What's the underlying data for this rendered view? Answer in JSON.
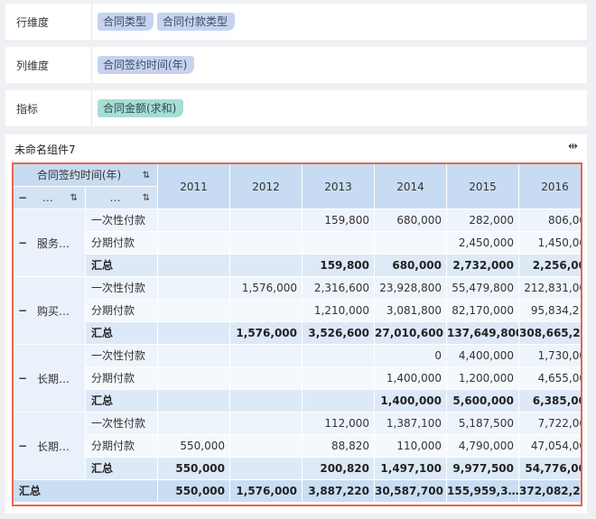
{
  "config": {
    "row_dim": {
      "label": "行维度",
      "chips": [
        "合同类型",
        "合同付款类型"
      ]
    },
    "col_dim": {
      "label": "列维度",
      "chips": [
        "合同签约时间(年)"
      ]
    },
    "metric": {
      "label": "指标",
      "chips": [
        "合同金额(求和)"
      ]
    }
  },
  "widget": {
    "title": "未命名组件7",
    "expand_icon": "⇹",
    "header": {
      "col_field": "合同签约时间(年)",
      "row_field_1": "…",
      "row_field_2": "…",
      "minus": "−",
      "sort_icon": "⇅",
      "years": [
        "2011",
        "2012",
        "2013",
        "2014",
        "2015",
        "2016"
      ]
    },
    "groups": [
      {
        "name": "服务…",
        "rows": [
          {
            "label": "一次性付款",
            "values": [
              "",
              "",
              "159,800",
              "680,000",
              "282,000",
              "806,00"
            ]
          },
          {
            "label": "分期付款",
            "values": [
              "",
              "",
              "",
              "",
              "2,450,000",
              "1,450,00"
            ]
          }
        ],
        "subtotal": {
          "label": "汇总",
          "values": [
            "",
            "",
            "159,800",
            "680,000",
            "2,732,000",
            "2,256,00"
          ]
        }
      },
      {
        "name": "购买…",
        "rows": [
          {
            "label": "一次性付款",
            "values": [
              "",
              "1,576,000",
              "2,316,600",
              "23,928,800",
              "55,479,800",
              "212,831,00"
            ]
          },
          {
            "label": "分期付款",
            "values": [
              "",
              "",
              "1,210,000",
              "3,081,800",
              "82,170,000",
              "95,834,21"
            ]
          }
        ],
        "subtotal": {
          "label": "汇总",
          "values": [
            "",
            "1,576,000",
            "3,526,600",
            "27,010,600",
            "137,649,800",
            "308,665,2…"
          ]
        }
      },
      {
        "name": "长期…",
        "rows": [
          {
            "label": "一次性付款",
            "values": [
              "",
              "",
              "",
              "0",
              "4,400,000",
              "1,730,00"
            ]
          },
          {
            "label": "分期付款",
            "values": [
              "",
              "",
              "",
              "1,400,000",
              "1,200,000",
              "4,655,00"
            ]
          }
        ],
        "subtotal": {
          "label": "汇总",
          "values": [
            "",
            "",
            "",
            "1,400,000",
            "5,600,000",
            "6,385,00"
          ]
        }
      },
      {
        "name": "长期…",
        "rows": [
          {
            "label": "一次性付款",
            "values": [
              "",
              "",
              "112,000",
              "1,387,100",
              "5,187,500",
              "7,722,00"
            ]
          },
          {
            "label": "分期付款",
            "values": [
              "550,000",
              "",
              "88,820",
              "110,000",
              "4,790,000",
              "47,054,00"
            ]
          }
        ],
        "subtotal": {
          "label": "汇总",
          "values": [
            "550,000",
            "",
            "200,820",
            "1,497,100",
            "9,977,500",
            "54,776,00"
          ]
        }
      }
    ],
    "grand_total": {
      "label": "汇总",
      "values": [
        "550,000",
        "1,576,000",
        "3,887,220",
        "30,587,700",
        "155,959,3…",
        "372,082,21"
      ]
    }
  },
  "colors": {
    "accent_border": "#e86452",
    "chip_blue": "#c5d3ef",
    "chip_green": "#a7ddd5"
  }
}
